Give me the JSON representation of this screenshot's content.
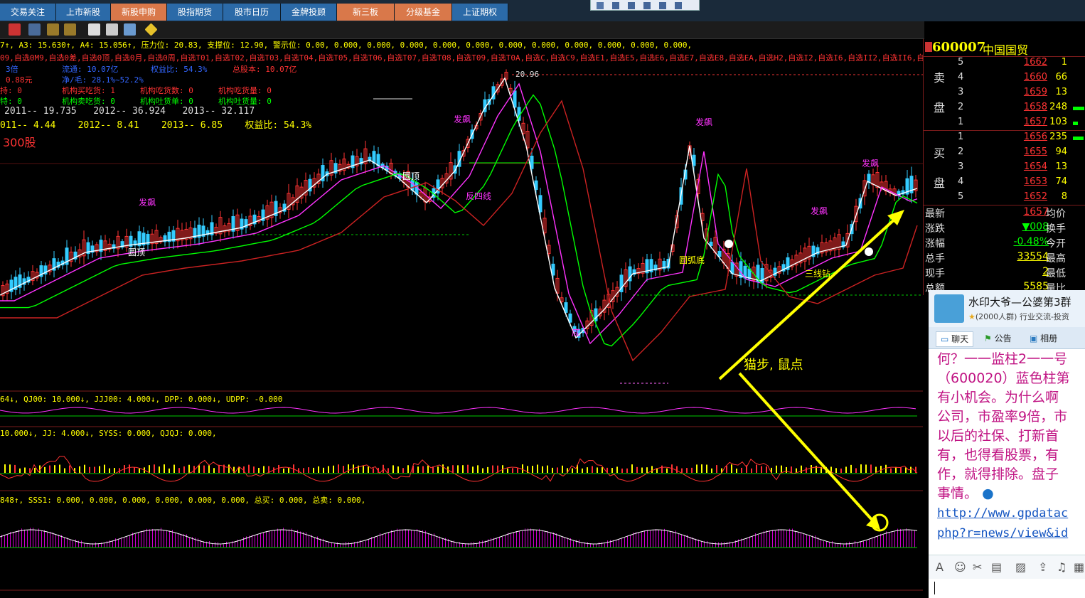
{
  "tabs": [
    {
      "label": "交易关注",
      "style": "blue"
    },
    {
      "label": "上市新股",
      "style": "blue"
    },
    {
      "label": "新股申购",
      "style": "orange"
    },
    {
      "label": "股指期货",
      "style": "blue"
    },
    {
      "label": "股市日历",
      "style": "blue"
    },
    {
      "label": "金牌投顾",
      "style": "blue"
    },
    {
      "label": "新三板",
      "style": "orange"
    },
    {
      "label": "分级基金",
      "style": "orange"
    },
    {
      "label": "上证期权",
      "style": "blue"
    }
  ],
  "main_chart": {
    "info_line1": "7↑, A3: 15.630↑, A4: 15.056↑, 压力位: 20.83, 支撑位: 12.90, 警示位: 0.00, 0.000, 0.000, 0.000, 0.000, 0.000, 0.000, 0.000, 0.000, 0.000, 0.000, 0.000,",
    "info_line2": "09,自选0M9,自选0差,自选0顶,自选0月,自选0周,自选T01,自选T02,自选T03,自选T04,自选T05,自选T06,自选T07,自选T08,自选T09,自选T0A,自选C,自选C9,自选E1,自选E5,自选E6,自选E7,自选E8,自选EA,自选H2,自选I2,自选I6,自选II2,自选II6,自",
    "f_row1_a": "3倍",
    "f_row1_b": "流通: 10.07亿",
    "f_row1_c": "权益比: 54.3%",
    "f_row1_d": "总股本: 10.07亿",
    "f_row2_a": "0.88元",
    "f_row2_b": "净/毛: 28.1%~52.2%",
    "f_row3_a": "持: 0",
    "f_row3_b": "机构买吃货: 1",
    "f_row3_c": "机构吃货数: 0",
    "f_row3_d": "机构吃货量: 0",
    "f_row4_a": "特: 0",
    "f_row4_b": "机构卖吃货: 0",
    "f_row4_c": "机构吐货单: 0",
    "f_row4_d": "机构吐货量: 0",
    "eps_row": "2011-- 19.735   2012-- 36.924   2013-- 32.117",
    "pe_row": "011-- 4.44    2012-- 8.41    2013-- 6.85    权益比: 54.3%",
    "hs300": "300股",
    "high_label": "20.96",
    "annotation_text": "猫步, 鼠点",
    "labels": {
      "yuanding1": "圆顶",
      "yuanding2": "圆顶",
      "fapiao1": "发飙",
      "fapiao2": "发飙",
      "fapiao3": "发飙",
      "fapiao4": "发飙",
      "fapiao5": "发飙",
      "yuanhudi": "圆弧底",
      "sanxian": "三线钻",
      "fanjixian": "反四线",
      "di": "底"
    }
  },
  "ind1": {
    "line": "64↓, QJ00: 10.000↓, JJJ00: 4.000↓, DPP: 0.000↓, UDPP: -0.000"
  },
  "ind2": {
    "line": "10.000↓, JJ: 4.000↓, SYSS: 0.000, QJQJ: 0.000,"
  },
  "ind3": {
    "line": "848↑, SSS1: 0.000, 0.000, 0.000, 0.000, 0.000, 0.000, 总买: 0.000, 总卖: 0.000,"
  },
  "quote": {
    "code": "600007",
    "name": "中国国贸",
    "sell_label_top": "卖",
    "sell_label_bottom": "盘",
    "buy_label_top": "买",
    "buy_label_bottom": "盘",
    "asks": [
      {
        "idx": "5",
        "price": "1662",
        "vol": "1",
        "bar": 0
      },
      {
        "idx": "4",
        "price": "1660",
        "vol": "66",
        "bar": 0
      },
      {
        "idx": "3",
        "price": "1659",
        "vol": "13",
        "bar": 0
      },
      {
        "idx": "2",
        "price": "1658",
        "vol": "248",
        "bar": 0.9
      },
      {
        "idx": "1",
        "price": "1657",
        "vol": "103",
        "bar": 0.4
      }
    ],
    "bids": [
      {
        "idx": "1",
        "price": "1656",
        "vol": "235",
        "bar": 0.85
      },
      {
        "idx": "2",
        "price": "1655",
        "vol": "94",
        "bar": 0
      },
      {
        "idx": "3",
        "price": "1654",
        "vol": "13",
        "bar": 0
      },
      {
        "idx": "4",
        "price": "1653",
        "vol": "74",
        "bar": 0
      },
      {
        "idx": "5",
        "price": "1652",
        "vol": "8",
        "bar": 0
      }
    ],
    "stats": [
      {
        "k": "最新",
        "v": "1657",
        "k2": "均价",
        "color": "#f33"
      },
      {
        "k": "涨跌",
        "v": "▼008",
        "k2": "换手",
        "color": "#0f0"
      },
      {
        "k": "涨幅",
        "v": "-0.48%",
        "k2": "今开",
        "color": "#0f0"
      },
      {
        "k": "总手",
        "v": "33554",
        "k2": "最高",
        "color": "#ff0"
      },
      {
        "k": "现手",
        "v": "2",
        "k2": "最低",
        "color": "#ff0"
      },
      {
        "k": "总额",
        "v": "5585",
        "k2": "量比",
        "color": "#ff0"
      }
    ]
  },
  "chat": {
    "group_name": "水印大爷—公婆第3群",
    "group_meta": "(2000人群) 行业交流-投资",
    "tab_chat": "聊天",
    "tab_notice": "公告",
    "tab_album": "相册",
    "lines": [
      "何？一一监柱2一一号",
      "（600020）蓝色柱第",
      "有小机会。为什么啊",
      "公司，市盈率9倍，市",
      "以后的社保、打新首",
      "有，也得看股票，有",
      "作，就得排除。盘子",
      "事情。"
    ],
    "link1": "http://www.gpdatac",
    "link2": "php?r=news/view&id"
  }
}
